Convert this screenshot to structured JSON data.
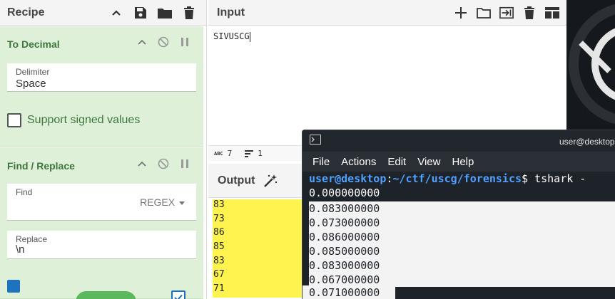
{
  "recipe": {
    "title": "Recipe",
    "operations": [
      {
        "title": "To Decimal",
        "delimiter_label": "Delimiter",
        "delimiter_value": "Space",
        "checkbox_label": "Support signed values"
      },
      {
        "title": "Find / Replace",
        "find_label": "Find",
        "find_value": "",
        "find_mode": "REGEX",
        "replace_label": "Replace",
        "replace_value": "\\n"
      }
    ]
  },
  "input": {
    "title": "Input",
    "text": "SIVUSCG",
    "status_chars": "7",
    "status_lines": "1"
  },
  "output": {
    "title": "Output",
    "lines": [
      "83",
      "73",
      "86",
      "85",
      "83",
      "67",
      "71"
    ]
  },
  "terminal": {
    "title": "user@desktop",
    "menu": [
      "File",
      "Actions",
      "Edit",
      "View",
      "Help"
    ],
    "prompt_user": "user@desktop",
    "prompt_sep": ":",
    "prompt_path": "~/ctf/uscg/forensics",
    "prompt_cmd": "$ tshark -",
    "lines_plain": [
      "0.000000000"
    ],
    "lines_selected": [
      "0.083000000",
      "0.073000000",
      "0.086000000",
      "0.085000000",
      "0.083000000",
      "0.067000000"
    ],
    "last_line": "0.071000000"
  },
  "colors": {
    "recipe_op_bg": "#dff0d8",
    "recipe_text_green": "#3c763d",
    "output_highlight": "#fff44f",
    "terminal_bg": "#1e2229",
    "prompt_blue": "#4fa0ff"
  }
}
